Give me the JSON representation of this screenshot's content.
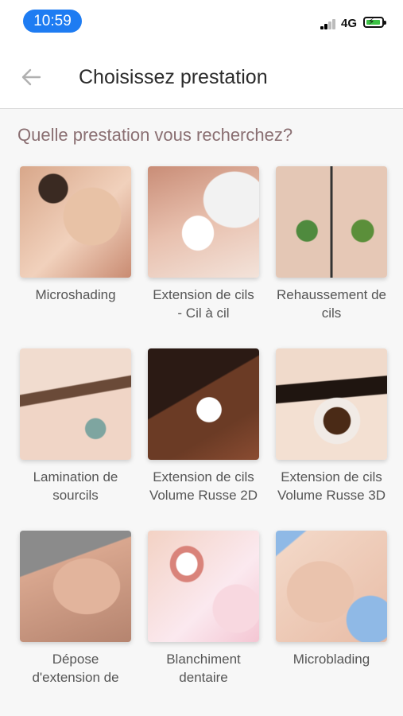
{
  "status": {
    "time": "10:59",
    "network": "4G"
  },
  "header": {
    "title": "Choisissez prestation",
    "back_icon": "arrow-left-icon"
  },
  "question": "Quelle prestation vous recherchez?",
  "services": [
    {
      "line1": "Microshading",
      "line2": ""
    },
    {
      "line1": "Extension de cils",
      "line2": "- Cil à cil"
    },
    {
      "line1": "Rehaussement de",
      "line2": "cils"
    },
    {
      "line1": "Lamination de",
      "line2": "sourcils"
    },
    {
      "line1": "Extension de cils",
      "line2": "Volume Russe 2D"
    },
    {
      "line1": "Extension de cils",
      "line2": "Volume Russe 3D"
    },
    {
      "line1": "Dépose",
      "line2": "d'extension de"
    },
    {
      "line1": "Blanchiment",
      "line2": "dentaire"
    },
    {
      "line1": "Microblading",
      "line2": ""
    }
  ],
  "colors": {
    "accent": "#1e7cf2",
    "question": "#8a6f72",
    "battery": "#3cc245"
  }
}
